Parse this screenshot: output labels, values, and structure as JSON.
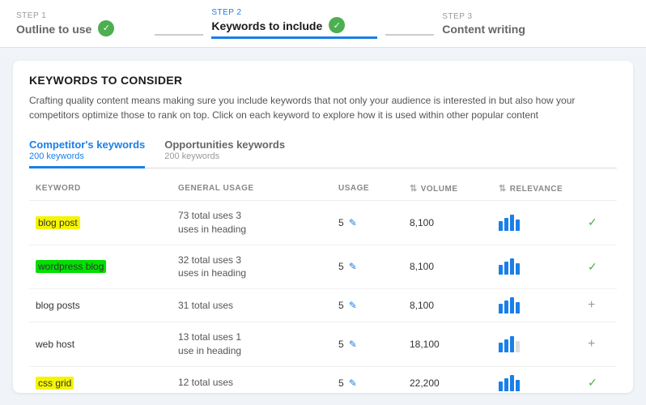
{
  "stepper": {
    "steps": [
      {
        "id": "step1",
        "number": "STEP 1",
        "label": "Outline to use",
        "state": "completed"
      },
      {
        "id": "step2",
        "number": "STEP 2",
        "label": "Keywords to include",
        "state": "active"
      },
      {
        "id": "step3",
        "number": "STEP 3",
        "label": "Content writing",
        "state": "inactive"
      }
    ]
  },
  "card": {
    "title": "KEYWORDS TO CONSIDER",
    "description": "Crafting quality content means making sure you include keywords that not only your audience is interested in but also how your competitors optimize those to rank on top. Click on each keyword to explore how it is used within other popular content"
  },
  "tabs": [
    {
      "id": "competitors",
      "label": "Competitor's keywords",
      "count": "200 keywords",
      "active": true
    },
    {
      "id": "opportunities",
      "label": "Opportunities keywords",
      "count": "200 keywords",
      "active": false
    }
  ],
  "table": {
    "headers": [
      {
        "id": "keyword",
        "label": "KEYWORD",
        "sortable": false
      },
      {
        "id": "general_usage",
        "label": "GENERAL USAGE",
        "sortable": false
      },
      {
        "id": "usage",
        "label": "USAGE",
        "sortable": false
      },
      {
        "id": "volume",
        "label": "VOLUME",
        "sortable": true
      },
      {
        "id": "relevance",
        "label": "RELEVANCE",
        "sortable": true
      },
      {
        "id": "action",
        "label": "",
        "sortable": false
      }
    ],
    "rows": [
      {
        "keyword": "blog post",
        "keyword_highlight": "yellow",
        "general_usage": "73 total uses 3 uses in heading",
        "usage": "5",
        "volume": "8,100",
        "bars": [
          3,
          3,
          3,
          2
        ],
        "action": "check"
      },
      {
        "keyword": "wordpress blog",
        "keyword_highlight": "green",
        "general_usage": "32 total uses 3 uses in heading",
        "usage": "5",
        "volume": "8,100",
        "bars": [
          3,
          3,
          3,
          2
        ],
        "action": "check"
      },
      {
        "keyword": "blog posts",
        "keyword_highlight": "none",
        "general_usage": "31 total uses",
        "usage": "5",
        "volume": "8,100",
        "bars": [
          3,
          3,
          3,
          2
        ],
        "action": "plus"
      },
      {
        "keyword": "web host",
        "keyword_highlight": "none",
        "general_usage": "13 total uses 1 use in heading",
        "usage": "5",
        "volume": "18,100",
        "bars": [
          2,
          2,
          2,
          1
        ],
        "action": "plus"
      },
      {
        "keyword": "css grid",
        "keyword_highlight": "yellow",
        "general_usage": "12 total uses",
        "usage": "5",
        "volume": "22,200",
        "bars": [
          3,
          3,
          3,
          3
        ],
        "action": "check"
      }
    ]
  },
  "icons": {
    "check_unicode": "✓",
    "plus_unicode": "+",
    "edit_unicode": "✎",
    "sort_unicode": "⇅"
  }
}
